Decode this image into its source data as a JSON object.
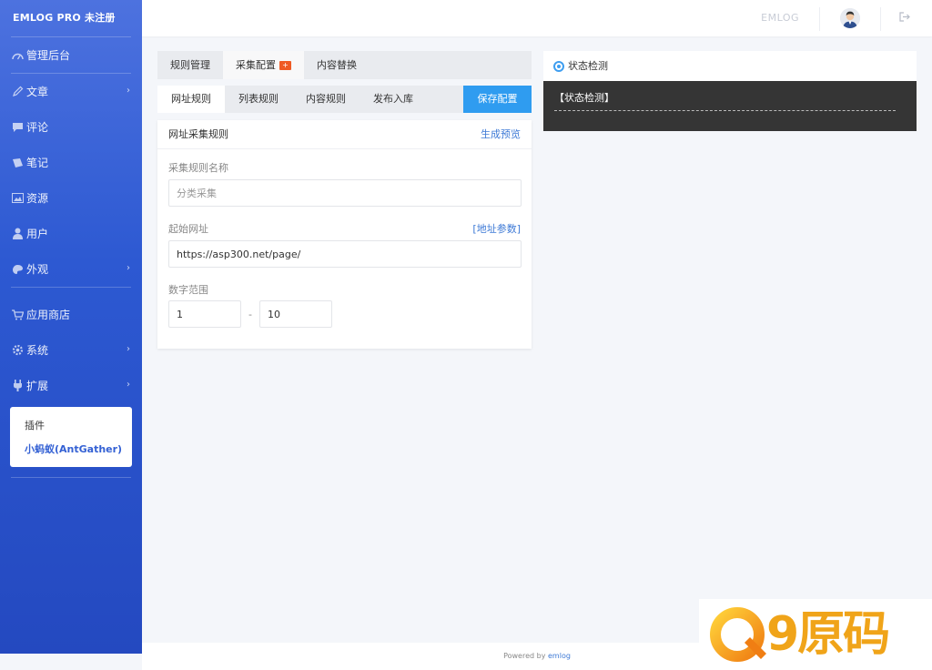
{
  "app": {
    "brand": "EMLOG PRO 未注册"
  },
  "sidebar": {
    "items": [
      {
        "label": "管理后台",
        "icon": "dashboard-icon"
      },
      {
        "label": "文章",
        "icon": "pencil-icon",
        "has_children": true
      },
      {
        "label": "评论",
        "icon": "comment-icon"
      },
      {
        "label": "笔记",
        "icon": "note-icon"
      },
      {
        "label": "资源",
        "icon": "image-icon"
      },
      {
        "label": "用户",
        "icon": "user-icon"
      },
      {
        "label": "外观",
        "icon": "palette-icon",
        "has_children": true
      },
      {
        "label": "应用商店",
        "icon": "cart-icon"
      },
      {
        "label": "系统",
        "icon": "gear-icon",
        "has_children": true
      },
      {
        "label": "扩展",
        "icon": "plug-icon",
        "has_children": true
      }
    ],
    "submenu": [
      {
        "label": "插件"
      },
      {
        "label": "小蚂蚁(AntGather)",
        "active": true
      }
    ]
  },
  "topbar": {
    "emlog_label": "EMLOG"
  },
  "tabs_top": [
    {
      "label": "规则管理"
    },
    {
      "label": "采集配置",
      "badge": "+",
      "active": true
    },
    {
      "label": "内容替换"
    }
  ],
  "tabs_sub": [
    {
      "label": "网址规则",
      "active": true
    },
    {
      "label": "列表规则"
    },
    {
      "label": "内容规则"
    },
    {
      "label": "发布入库"
    }
  ],
  "save_button": "保存配置",
  "card": {
    "title": "网址采集规则",
    "preview_link": "生成预览",
    "rule_name_label": "采集规则名称",
    "rule_name_placeholder": "分类采集",
    "start_url_label": "起始网址",
    "url_params_link": "[地址参数]",
    "start_url_value": "https://asp300.net/page/",
    "range_label": "数字范围",
    "range_from": "1",
    "range_sep": "-",
    "range_to": "10"
  },
  "status": {
    "title": "状态检测",
    "body_text": "【状态检测】"
  },
  "footer": {
    "powered_by": "Powered by",
    "emlog_link": "emlog"
  },
  "watermark": {
    "text": "9原码",
    "color": "#f0a419"
  },
  "colors": {
    "sidebar_top": "#4d72df",
    "sidebar_bottom": "#2449c0",
    "accent": "#2f9cf0",
    "link": "#3e7ad6",
    "badge": "#ef5a24",
    "console_bg": "#353535"
  }
}
